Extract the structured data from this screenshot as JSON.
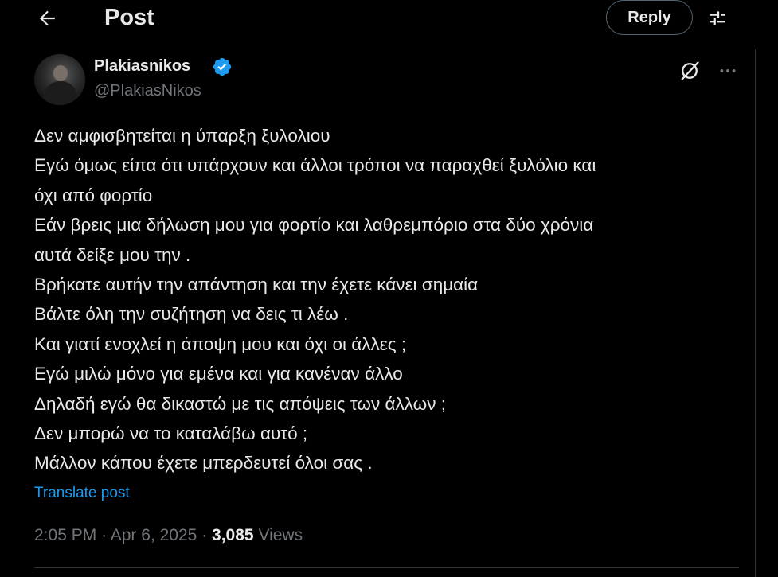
{
  "header": {
    "title": "Post",
    "reply_label": "Reply"
  },
  "author": {
    "display_name": "Plakiasnikos",
    "handle": "@PlakiasNikos",
    "verified": true
  },
  "post": {
    "lines": [
      "Δεν αμφισβητείται η ύπαρξη ξυλολιου",
      "Εγώ όμως είπα ότι υπάρχουν και άλλοι τρόποι να παραχθεί ξυλόλιο και",
      "όχι από φορτίο",
      "Εάν βρεις μια δήλωση μου για φορτίο και λαθρεμπόριο στα δύο χρόνια",
      "αυτά δείξε μου την .",
      "Βρήκατε αυτήν την απάντηση και την έχετε κάνει σημαία",
      "Βάλτε όλη την συζήτηση να δεις τι λέω .",
      "Και γιατί ενοχλεί η άποψη μου και όχι οι άλλες ;",
      "Εγώ μιλώ μόνο για εμένα και για κανέναν άλλο",
      "Δηλαδή εγώ θα δικαστώ με τις απόψεις των άλλων ;",
      "Δεν μπορώ να το καταλάβω αυτό ;",
      "Μάλλον κάπου έχετε μπερδευτεί όλοι σας ."
    ],
    "translate_label": "Translate post",
    "time": "2:05 PM",
    "date": "Apr 6, 2025",
    "views_count": "3,085",
    "views_label": "Views",
    "separator": "·"
  },
  "icons": {
    "back": "arrow-left-icon",
    "filter": "sliders-icon",
    "grok": "grok-icon",
    "more": "more-icon",
    "verified": "verified-badge-icon"
  },
  "colors": {
    "background": "#000000",
    "text": "#e7e9ea",
    "muted": "#71767b",
    "accent": "#1d9bf0",
    "border": "#2f3336"
  }
}
